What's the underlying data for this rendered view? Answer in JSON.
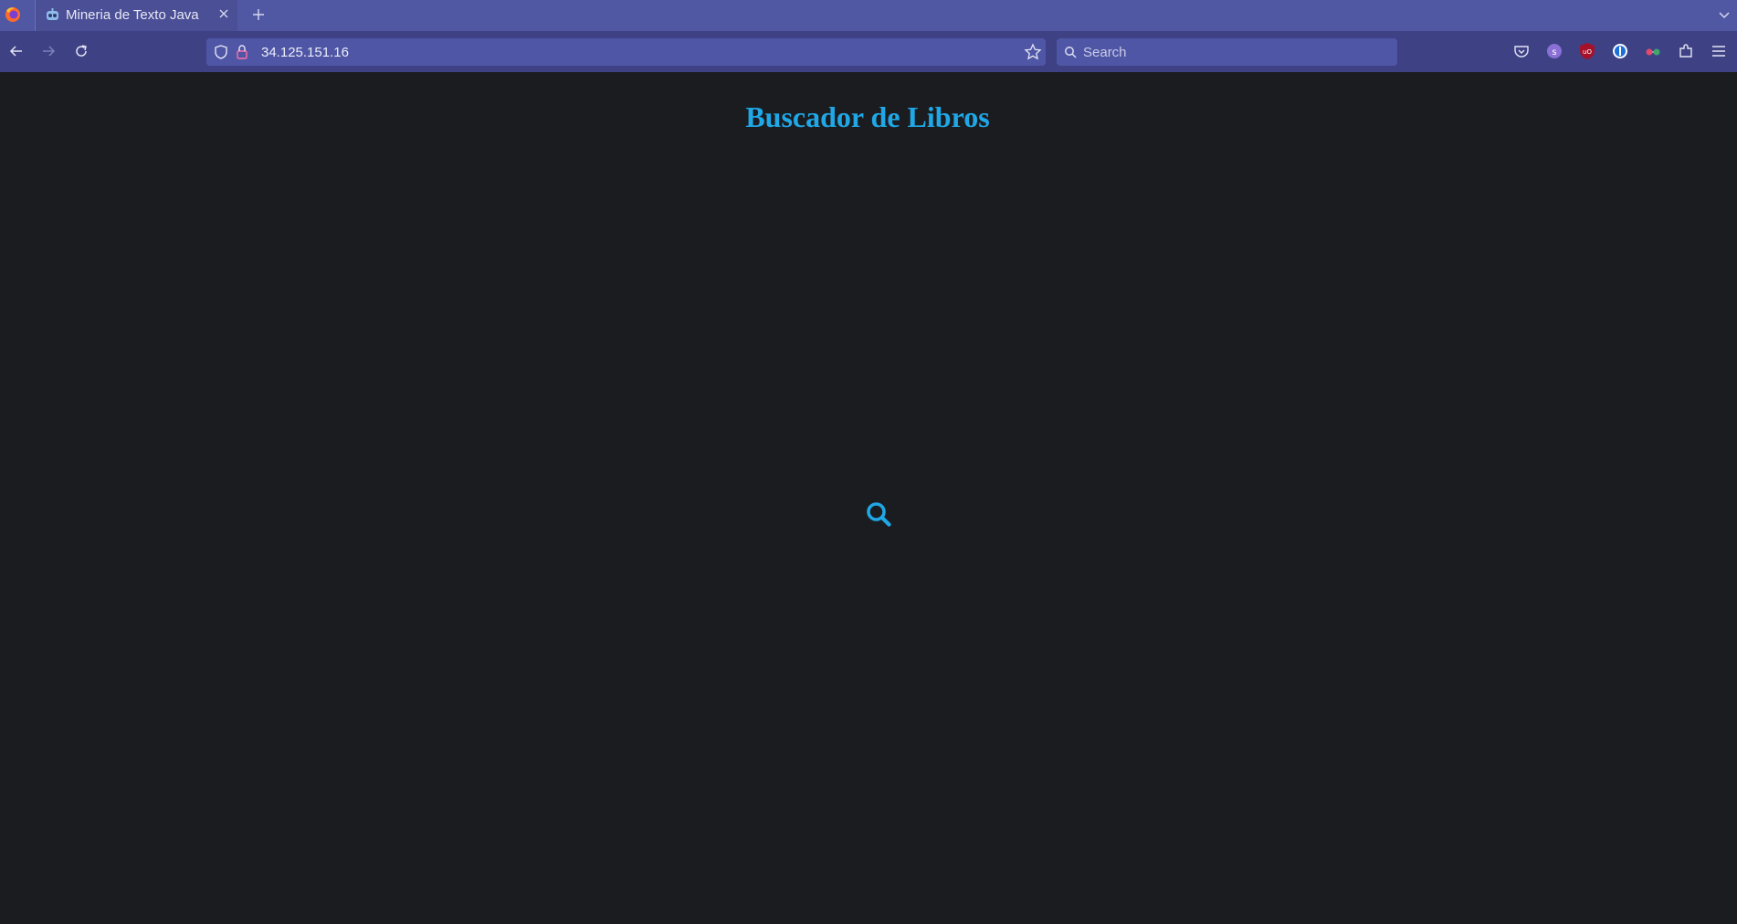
{
  "browser": {
    "tab": {
      "title": "Mineria de Texto Java"
    },
    "url": "34.125.151.16",
    "search_placeholder": "Search"
  },
  "page": {
    "title": "Buscador de Libros"
  },
  "icons": {
    "back": "arrow-left-icon",
    "forward": "arrow-right-icon",
    "reload": "reload-icon",
    "search": "magnifier-icon"
  },
  "colors": {
    "accent": "#1fa7e6",
    "background": "#1b1c1f",
    "toolbar": "#3e4284",
    "tabbar": "#5057a3"
  }
}
